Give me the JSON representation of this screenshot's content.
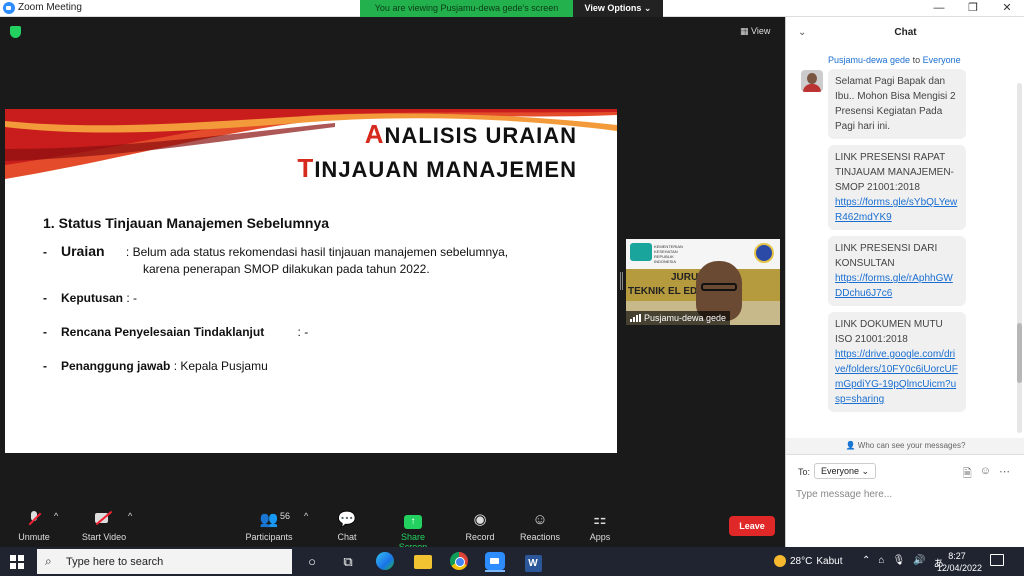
{
  "window": {
    "title": "Zoom Meeting",
    "viewing_banner": "You are viewing Pusjamu-dewa gede's screen",
    "view_options": "View Options ⌄",
    "minimize": "—",
    "maximize": "❐",
    "close": "✕"
  },
  "meeting": {
    "view_label": "View",
    "slide": {
      "title1_first": "A",
      "title1_rest": "NALISIS URAIAN",
      "title2_first": "T",
      "title2_rest": "INJAUAN MANAJEMEN",
      "heading": "1. Status Tinjauan Manajemen Sebelumnya",
      "uraian_label": "Uraian",
      "uraian_text": ": Belum ada status rekomendasi hasil tinjauan manajemen sebelumnya,",
      "uraian_text2": "karena penerapan SMOP dilakukan pada tahun 2022.",
      "keputusan_label": "Keputusan",
      "keputusan_value": ": -",
      "rencana_label": "Rencana Penyelesaian Tindaklanjut",
      "rencana_value": ": -",
      "penanggung_label": "Penanggung jawab",
      "penanggung_value": ": Kepala Pusjamu",
      "dash": "-"
    },
    "video": {
      "participant_name": "Pusjamu-dewa gede",
      "banner_text1": "JURU",
      "banner_text2": "TEKNIK EL          EDIK",
      "kemenkes_text": "KEMENTERIAN KESEHATAN REPUBLIK INDONESIA"
    }
  },
  "controls": {
    "unmute": "Unmute",
    "start_video": "Start Video",
    "participants": "Participants",
    "participants_count": "56",
    "chat": "Chat",
    "share_screen": "Share Screen",
    "record": "Record",
    "reactions": "Reactions",
    "apps": "Apps",
    "leave": "Leave",
    "caret": "^"
  },
  "chat": {
    "title": "Chat",
    "from": "Pusjamu-dewa gede",
    "to_word": "to",
    "to_target": "Everyone",
    "messages": [
      {
        "text": "Selamat Pagi Bapak dan Ibu.. Mohon Bisa Mengisi 2 Presensi Kegiatan Pada Pagi hari ini."
      },
      {
        "text": "LINK PRESENSI RAPAT TINJAUAM MANAJEMEN-SMOP 21001:2018",
        "link": "https://forms.gle/sYbQLYewR462mdYK9"
      },
      {
        "text": "LINK PRESENSI DARI KONSULTAN",
        "link": "https://forms.gle/rAphhGWDDchu6J7c6"
      },
      {
        "text": "LINK DOKUMEN MUTU ISO 21001:2018",
        "link": "https://drive.google.com/drive/folders/10FY0c6iUorcUFmGpdiYG-19pQlmcUicm?usp=sharing"
      }
    ],
    "privacy_note": "Who can see your messages?",
    "to_label": "To:",
    "to_dropdown": "Everyone ⌄",
    "input_placeholder": "Type message here..."
  },
  "taskbar": {
    "search_text": "Type here to search",
    "weather_temp": "28°C",
    "weather_desc": "Kabut",
    "time": "8:27",
    "date": "12/04/2022",
    "word_letter": "W"
  },
  "colors": {
    "zoom_blue": "#2d8cff",
    "banner_green": "#22b14c",
    "leave_red": "#e02828",
    "slide_accent_red": "#d62a1e"
  }
}
